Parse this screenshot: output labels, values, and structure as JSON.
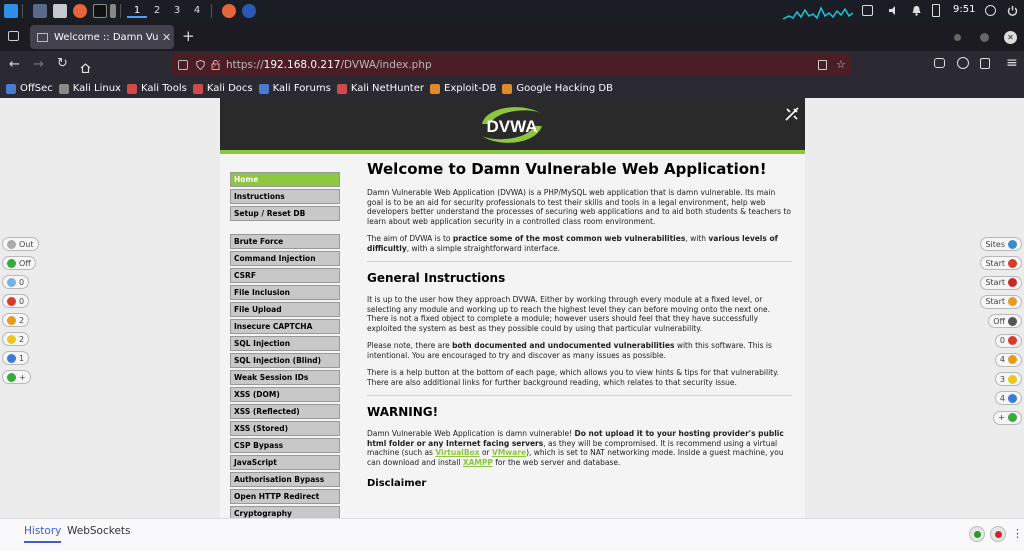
{
  "taskbar": {
    "workspaces": [
      "1",
      "2",
      "3",
      "4"
    ],
    "clock": "9:51"
  },
  "browser": {
    "tab_title": "Welcome :: Damn Vulnera",
    "url_prefix": "https://",
    "url_host": "192.168.0.217",
    "url_path": "/DVWA/index.php",
    "bookmarks": [
      {
        "label": "OffSec",
        "color": "#4a7bd0"
      },
      {
        "label": "Kali Linux",
        "color": "#8a8a8a"
      },
      {
        "label": "Kali Tools",
        "color": "#d04a4a"
      },
      {
        "label": "Kali Docs",
        "color": "#d04a4a"
      },
      {
        "label": "Kali Forums",
        "color": "#4a7bd0"
      },
      {
        "label": "Kali NetHunter",
        "color": "#d04a4a"
      },
      {
        "label": "Exploit-DB",
        "color": "#e08a2a"
      },
      {
        "label": "Google Hacking DB",
        "color": "#e08a2a"
      }
    ]
  },
  "dvwa": {
    "logo": "DVWA",
    "menu_group1": [
      "Home",
      "Instructions",
      "Setup / Reset DB"
    ],
    "menu_group2": [
      "Brute Force",
      "Command Injection",
      "CSRF",
      "File Inclusion",
      "File Upload",
      "Insecure CAPTCHA",
      "SQL Injection",
      "SQL Injection (Blind)",
      "Weak Session IDs",
      "XSS (DOM)",
      "XSS (Reflected)",
      "XSS (Stored)",
      "CSP Bypass",
      "JavaScript",
      "Authorisation Bypass",
      "Open HTTP Redirect",
      "Cryptography"
    ],
    "title": "Welcome to Damn Vulnerable Web Application!",
    "intro1": "Damn Vulnerable Web Application (DVWA) is a PHP/MySQL web application that is damn vulnerable. Its main goal is to be an aid for security professionals to test their skills and tools in a legal environment, help web developers better understand the processes of securing web applications and to aid both students & teachers to learn about web application security in a controlled class room environment.",
    "intro2_a": "The aim of DVWA is to ",
    "intro2_b": "practice some of the most common web vulnerabilities",
    "intro2_c": ", with ",
    "intro2_d": "various levels of difficultly",
    "intro2_e": ", with a simple straightforward interface.",
    "h_general": "General Instructions",
    "gen1": "It is up to the user how they approach DVWA. Either by working through every module at a fixed level, or selecting any module and working up to reach the highest level they can before moving onto the next one. There is not a fixed object to complete a module; however users should feel that they have successfully exploited the system as best as they possible could by using that particular vulnerability.",
    "gen2_a": "Please note, there are ",
    "gen2_b": "both documented and undocumented vulnerabilities",
    "gen2_c": " with this software. This is intentional. You are encouraged to try and discover as many issues as possible.",
    "gen3": "There is a help button at the bottom of each page, which allows you to view hints & tips for that vulnerability. There are also additional links for further background reading, which relates to that security issue.",
    "h_warning": "WARNING!",
    "warn_a": "Damn Vulnerable Web Application is damn vulnerable! ",
    "warn_b": "Do not upload it to your hosting provider's public html folder or any Internet facing servers",
    "warn_c": ", as they will be compromised. It is recommend using a virtual machine (such as ",
    "warn_link1": "VirtualBox",
    "warn_d": " or ",
    "warn_link2": "VMware",
    "warn_e": "), which is set to NAT networking mode. Inside a guest machine, you can download and install ",
    "warn_link3": "XAMPP",
    "warn_f": " for the web server and database.",
    "h_disclaimer": "Disclaimer"
  },
  "left_pills": [
    {
      "label": "Out",
      "color": "#aaaaaa"
    },
    {
      "label": "Off",
      "color": "#3aa83a"
    },
    {
      "label": "0",
      "color": "#7ab0e0"
    },
    {
      "label": "0",
      "color": "#d93a2a"
    },
    {
      "label": "2",
      "color": "#e89a20"
    },
    {
      "label": "2",
      "color": "#e8c820"
    },
    {
      "label": "1",
      "color": "#3a7ad9"
    },
    {
      "label": "+",
      "color": "#3aa83a"
    }
  ],
  "right_pills": [
    {
      "label": "Sites",
      "color": "#3a8ad0"
    },
    {
      "label": "Start",
      "color": "#d93a2a"
    },
    {
      "label": "Start",
      "color": "#c82a2a"
    },
    {
      "label": "Start",
      "color": "#e89a20"
    },
    {
      "label": "Off",
      "color": "#555555"
    },
    {
      "label": "0",
      "color": "#d93a2a"
    },
    {
      "label": "4",
      "color": "#e89a20"
    },
    {
      "label": "3",
      "color": "#e8c820"
    },
    {
      "label": "4",
      "color": "#3a7ad9"
    },
    {
      "label": "+",
      "color": "#3aa83a"
    }
  ],
  "bottom_tabs": {
    "history": "History",
    "websockets": "WebSockets"
  }
}
